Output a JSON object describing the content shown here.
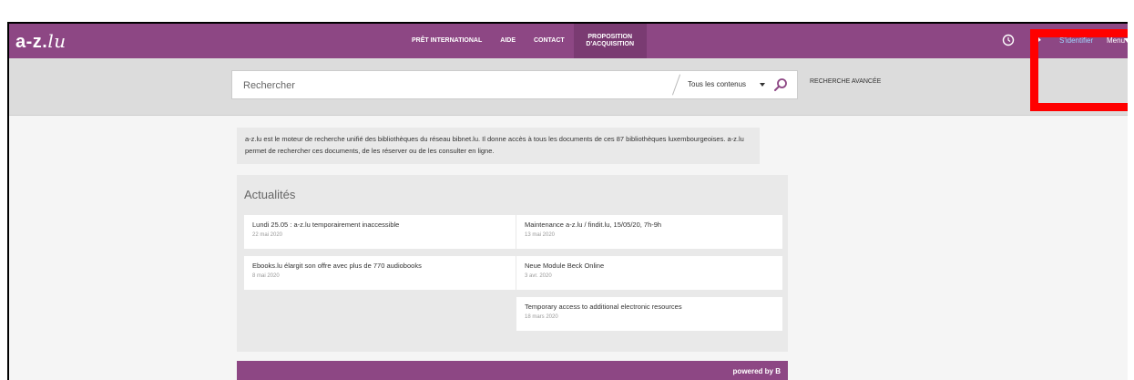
{
  "header": {
    "logo": "a-z.",
    "logo_suffix": "lu",
    "nav": [
      {
        "label": "PRÊT INTERNATIONAL"
      },
      {
        "label": "AIDE"
      },
      {
        "label": "CONTACT"
      },
      {
        "label": "PROPOSITION D'ACQUISITION"
      }
    ],
    "login_label": "S'identifier",
    "menu_label": "Menu",
    "icons": [
      "history-icon",
      "pin-icon",
      "chevron-down-icon"
    ],
    "colors": {
      "brand": "#8d4784",
      "login_link": "#9fd8ff",
      "highlight": "#ff0000"
    }
  },
  "search": {
    "placeholder": "Rechercher",
    "scope": "Tous les contenus",
    "advanced_label": "RECHERCHE AVANCÉE"
  },
  "intro": {
    "text": "a-z.lu est le moteur de recherche unifié des bibliothèques du réseau bibnet.lu. Il donne accès à tous les documents de ces 87 bibliothèques luxembourgeoises. a-z.lu permet de rechercher ces documents, de les réserver ou de les consulter en ligne."
  },
  "news": {
    "title": "Actualités",
    "items": [
      {
        "title": "Lundi 25.05 : a-z.lu temporairement inaccessible",
        "date": "22 mai 2020"
      },
      {
        "title": "Maintenance a-z.lu / findit.lu, 15/05/20, 7h-9h",
        "date": "13 mai 2020"
      },
      {
        "title": "Ebooks.lu élargit son offre avec plus de 770 audiobooks",
        "date": "8 mai 2020"
      },
      {
        "title": "Neue Module Beck Online",
        "date": "3 avr. 2020"
      },
      {
        "title": "Temporary access to additional electronic resources",
        "date": "18 mars 2020"
      }
    ]
  },
  "footer": {
    "powered_by": "powered by B"
  }
}
